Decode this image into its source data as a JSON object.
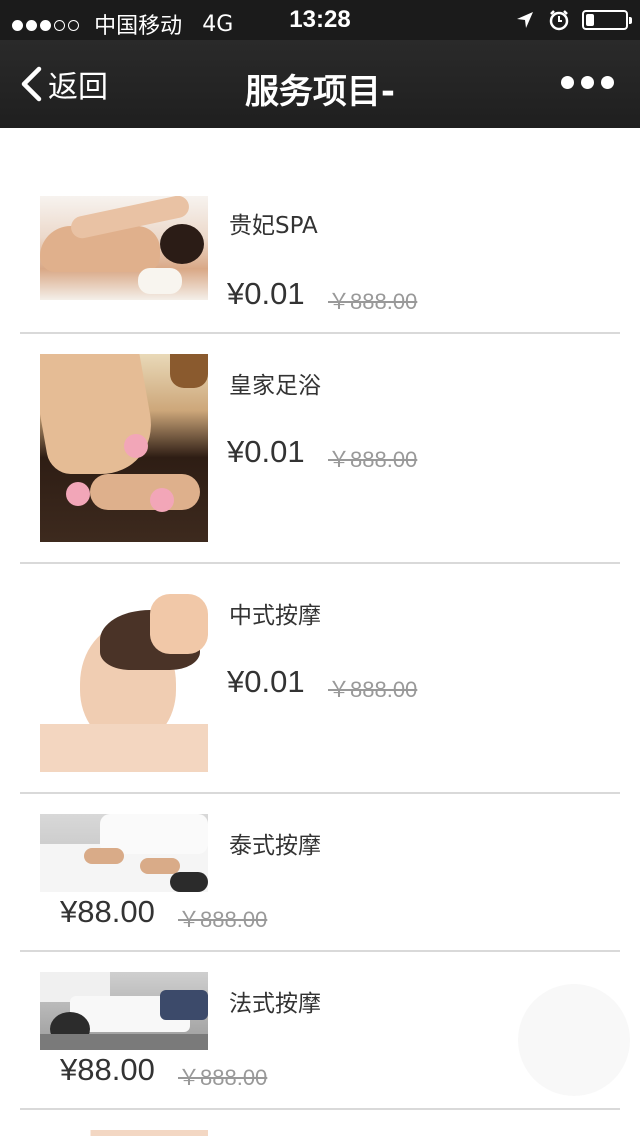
{
  "status_bar": {
    "signal_dots": [
      true,
      true,
      true,
      false,
      false
    ],
    "carrier": "中国移动",
    "network": "4G",
    "time": "13:28",
    "battery_level": 0.2,
    "icons": [
      "location-arrow-icon",
      "alarm-icon",
      "battery-icon"
    ]
  },
  "nav": {
    "back_label": "返回",
    "title": "服务项目-",
    "more_icon": "more-dots-icon"
  },
  "services": [
    {
      "name": "贵妃SPA",
      "price": "¥0.01",
      "original_price": "￥888.00",
      "image": "spa-massage-photo"
    },
    {
      "name": "皇家足浴",
      "price": "¥0.01",
      "original_price": "￥888.00",
      "image": "foot-bath-photo"
    },
    {
      "name": "中式按摩",
      "price": "¥0.01",
      "original_price": "￥888.00",
      "image": "head-massage-photo"
    },
    {
      "name": "泰式按摩",
      "price": "¥88.00",
      "original_price": "￥888.00",
      "image": "thai-massage-photo"
    },
    {
      "name": "法式按摩",
      "price": "¥88.00",
      "original_price": "￥888.00",
      "image": "french-massage-photo"
    }
  ],
  "colors": {
    "status_bar_bg": "#1b1b1b",
    "nav_bg": "#242424",
    "divider": "#d9d9d9",
    "text": "#333333",
    "muted": "#999999"
  }
}
